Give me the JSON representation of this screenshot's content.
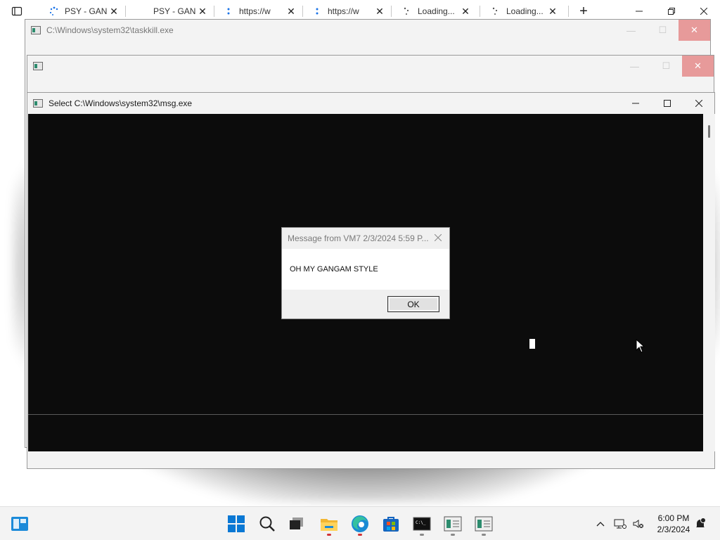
{
  "browser": {
    "tabs": [
      {
        "title": "PSY - GAN",
        "favicon": "loading-spinner-icon"
      },
      {
        "title": "PSY - GAN",
        "favicon": "blank"
      },
      {
        "title": "https://w",
        "favicon": "dots-icon"
      },
      {
        "title": "https://w",
        "favicon": "dots-icon"
      },
      {
        "title": "Loading...",
        "favicon": "loading-spinner-icon"
      },
      {
        "title": "Loading...",
        "favicon": "loading-spinner-icon"
      }
    ],
    "new_tab_label": "+",
    "close_glyph": "✕"
  },
  "windows": {
    "taskkill": {
      "title": "C:\\Windows\\system32\\taskkill.exe"
    },
    "blank": {
      "title": ""
    },
    "msg": {
      "title": "Select C:\\Windows\\system32\\msg.exe"
    }
  },
  "dialog": {
    "title": "Message from VM7 2/3/2024 5:59 P...",
    "message": "OH MY GANGAM STYLE",
    "ok_label": "OK"
  },
  "taskbar": {
    "time": "6:00 PM",
    "date": "2/3/2024",
    "pinned": [
      "start-icon",
      "search-icon",
      "task-view-icon",
      "file-explorer-icon",
      "edge-icon",
      "store-icon",
      "terminal-icon",
      "console-app-icon",
      "console-app-icon"
    ]
  },
  "colors": {
    "console_bg": "#0c0c0c",
    "taskbar_bg": "#f3f3f3",
    "close_inactive": "#e79a9a",
    "indicator_red": "#d13438"
  }
}
